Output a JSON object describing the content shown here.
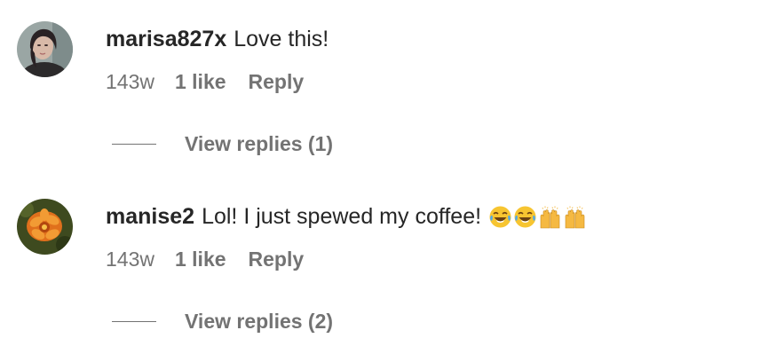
{
  "comments": [
    {
      "username": "marisa827x",
      "text": "Love this!",
      "time": "143w",
      "likes": "1 like",
      "reply_label": "Reply",
      "view_replies": "View replies (1)",
      "avatar_icon": "profile-photo-woman"
    },
    {
      "username": "manise2",
      "text": "Lol! I just spewed my coffee!",
      "emojis": [
        "face-with-tears-of-joy",
        "face-with-tears-of-joy",
        "raising-hands",
        "raising-hands"
      ],
      "time": "143w",
      "likes": "1 like",
      "reply_label": "Reply",
      "view_replies": "View replies (2)",
      "avatar_icon": "profile-photo-orange-flower"
    }
  ],
  "colors": {
    "text_primary": "#262626",
    "text_secondary": "#737373",
    "background": "#ffffff"
  }
}
